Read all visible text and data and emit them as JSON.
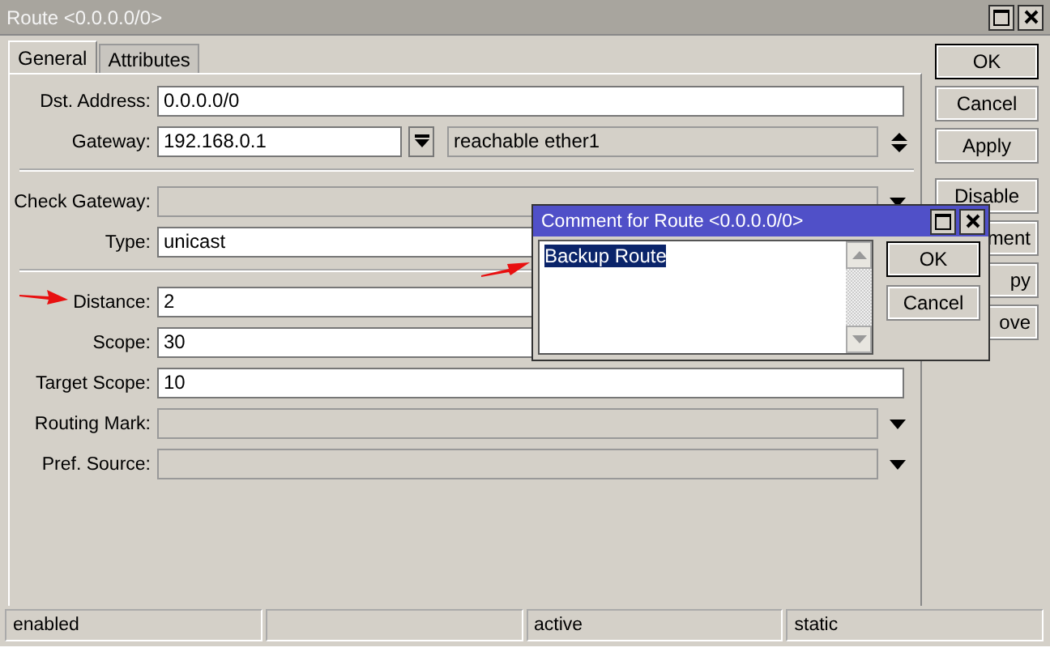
{
  "window": {
    "title": "Route <0.0.0.0/0>"
  },
  "tabs": [
    {
      "label": "General",
      "selected": true
    },
    {
      "label": "Attributes",
      "selected": false
    }
  ],
  "field_groups": [
    [
      {
        "label": "Dst. Address:",
        "value": "0.0.0.0/0",
        "disabled": false,
        "dropdown": false
      },
      {
        "label": "Gateway:",
        "value": "192.168.0.1",
        "kind": "gateway",
        "status": "reachable ether1"
      }
    ],
    [
      {
        "label": "Check Gateway:",
        "disabled": true,
        "dropdown": true
      },
      {
        "label": "Type:",
        "value": "unicast",
        "disabled": false,
        "dropdown": false
      }
    ],
    [
      {
        "label": "Distance:",
        "value": "2",
        "disabled": false,
        "dropdown": false
      },
      {
        "label": "Scope:",
        "value": "30",
        "disabled": false,
        "dropdown": false
      },
      {
        "label": "Target Scope:",
        "value": "10",
        "disabled": false,
        "dropdown": false
      },
      {
        "label": "Routing Mark:",
        "disabled": true,
        "dropdown": true
      },
      {
        "label": "Pref. Source:",
        "disabled": true,
        "dropdown": true
      }
    ]
  ],
  "side_buttons": [
    {
      "label": "OK",
      "default": true,
      "partly_covered": false
    },
    {
      "label": "Cancel",
      "default": false,
      "partly_covered": false
    },
    {
      "label": "Apply",
      "default": false,
      "partly_covered": false
    },
    {
      "label": "Disable",
      "default": false,
      "partly_covered": false
    },
    {
      "label": "ment",
      "default": false,
      "partly_covered": true
    },
    {
      "label": "py",
      "default": false,
      "partly_covered": true
    },
    {
      "label": "ove",
      "default": false,
      "partly_covered": true
    }
  ],
  "dialog": {
    "title": "Comment for Route <0.0.0.0/0>",
    "text": "Backup Route",
    "text_selected": true,
    "buttons": [
      {
        "label": "OK",
        "default": true
      },
      {
        "label": "Cancel",
        "default": false
      }
    ]
  },
  "status_bar": {
    "cell_1": "enabled",
    "cell_3": "active",
    "cell_4": "static"
  }
}
